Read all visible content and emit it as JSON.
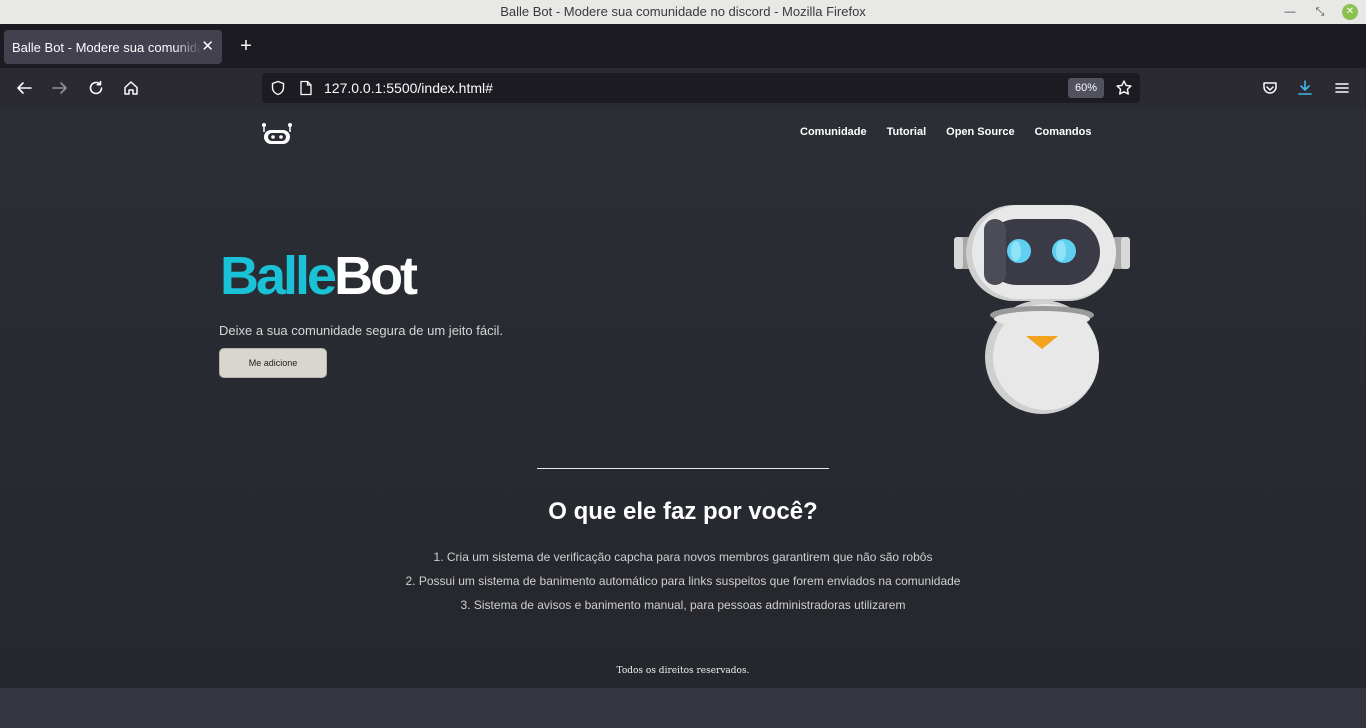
{
  "window": {
    "title": "Balle Bot - Modere sua comunidade no discord - Mozilla Firefox"
  },
  "tab": {
    "title": "Balle Bot - Modere sua comunidade no discord",
    "close_label": "✕",
    "new_tab_label": "+"
  },
  "navbar": {
    "url": "127.0.0.1:5500/index.html#",
    "zoom": "60%"
  },
  "site": {
    "nav": [
      "Comunidade",
      "Tutorial",
      "Open Source",
      "Comandos"
    ],
    "hero": {
      "title_part1": "Balle",
      "title_part2": "Bot",
      "subtitle": "Deixe a sua comunidade segura de um jeito fácil.",
      "button": "Me adicione"
    },
    "section_title": "O que ele faz por você?",
    "features": [
      "1. Cria um sistema de verificação capcha para novos membros garantirem que não são robôs",
      "2. Possui um sistema de banimento automático para links suspeitos que forem enviados na comunidade",
      "3. Sistema de avisos e banimento manual, para pessoas administradoras utilizarem"
    ],
    "footer": "Todos os direitos reservados."
  },
  "colors": {
    "accent": "#19c2d6",
    "page_bg": "#2a2d34",
    "button_bg": "#d9d5cf"
  }
}
